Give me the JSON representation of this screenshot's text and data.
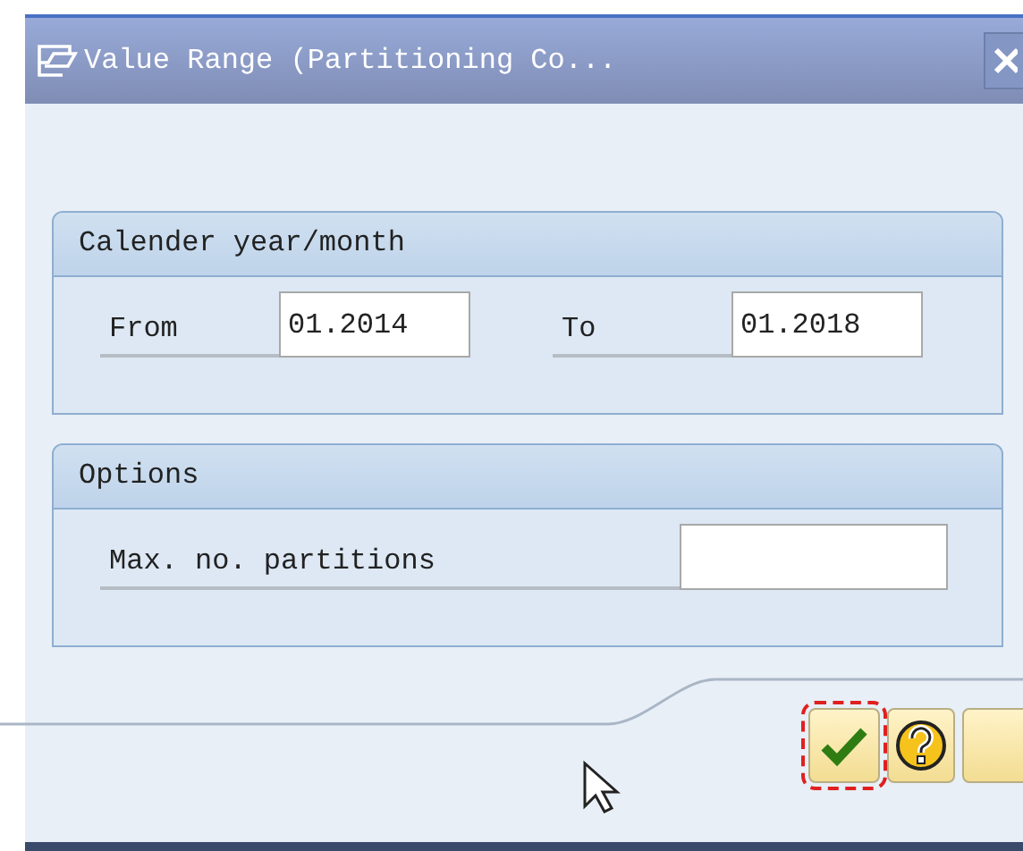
{
  "window": {
    "title": "Value Range (Partitioning Co..."
  },
  "groups": [
    {
      "title": "Calender year/month",
      "fields": [
        {
          "label": "From",
          "value": "01.2014"
        },
        {
          "label": "To",
          "value": "01.2018"
        }
      ]
    },
    {
      "title": "Options",
      "fields": [
        {
          "label": "Max. no. partitions"
        }
      ]
    }
  ],
  "buttons": [
    {
      "kind": "confirm",
      "focused": true
    },
    {
      "kind": "help",
      "focused": false
    },
    {
      "kind": "blank",
      "focused": false
    }
  ]
}
